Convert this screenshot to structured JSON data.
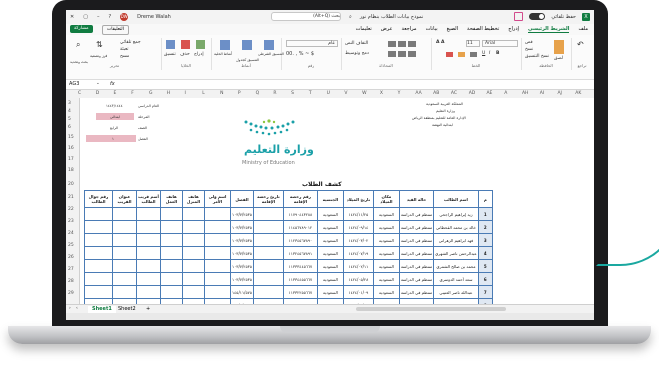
{
  "window": {
    "title": "نموذج بيانات الطلاب بنظام نور",
    "search_placeholder": "بحث (Alt+Q)",
    "user_name": "Dreme Walah",
    "user_initials": "DW",
    "autosave_label": "حفظ تلقائي"
  },
  "ribbon_tabs": {
    "file": "ملف",
    "home": "الشريط الرئيسي",
    "insert": "إدراج",
    "page_layout": "تخطيط الصفحة",
    "formulas": "الصيغ",
    "data": "بيانات",
    "review": "مراجعة",
    "view": "عرض",
    "help": "تعليمات"
  },
  "actions": {
    "share": "مشاركة",
    "comments": "التعليقات"
  },
  "ribbon_labels": {
    "undo": "تراجع",
    "clipboard": "الحافظة",
    "font": "الخط",
    "alignment": "المحاذاة",
    "number": "رقم",
    "styles": "أنماط",
    "cells": "الخلايا",
    "editing": "تحرير",
    "font_name": "Arial",
    "font_size": "11",
    "wrap_text": "التفاف النص",
    "merge_center": "دمج وتوسيط",
    "number_format": "عام",
    "conditional": "التنسيق الشرطي",
    "format_table": "التنسيق كجدول",
    "cell_styles": "أنماط الخلية",
    "insert": "إدراج",
    "delete": "حذف",
    "format": "تنسيق",
    "autosum": "جمع تلقائي",
    "fill": "تعبئة",
    "clear": "مسح",
    "sort_filter": "فرز وتصفية",
    "find_select": "بحث وتحديد",
    "paste": "لصق",
    "cut": "قص",
    "copy": "نسخ",
    "format_painter": "نسخ التنسيق"
  },
  "formula_bar": {
    "name_box": "AG3",
    "fx": "fx"
  },
  "columns": [
    "C",
    "D",
    "E",
    "F",
    "G",
    "H",
    "I",
    "L",
    "N",
    "P",
    "Q",
    "R",
    "S",
    "T",
    "U",
    "V",
    "W",
    "X",
    "Y",
    "AA",
    "AB",
    "AC",
    "AD",
    "AE",
    "A",
    "AH",
    "AI",
    "AJ",
    "AK"
  ],
  "rows": [
    "3",
    "4",
    "5",
    "6",
    "15",
    "16",
    "17",
    "18",
    "20",
    "21",
    "22",
    "23",
    "24",
    "25",
    "26",
    "27",
    "28",
    "29"
  ],
  "school_header": {
    "line1": "المملكة العربية السعودية",
    "line2": "وزارة التعليم",
    "line3": "الإدارة العامة للتعليم بمنطقة الرياض",
    "line4": "ابتدائية النهضة"
  },
  "info_left": {
    "date_label": "العام الدراسي",
    "date_value": "١٤٤٣/١٤٤٤",
    "stage_label": "المرحلة",
    "stage_value": "ابتدائي",
    "grade_label": "الصف",
    "grade_value": "الرابع",
    "section_label": "الفصل",
    "section_value": "١"
  },
  "logo": {
    "arabic": "وزارة التعليم",
    "english": "Ministry of Education"
  },
  "sheet_title": "كشف الطلاب",
  "table": {
    "headers": [
      "م",
      "اسم الطالب",
      "حالة القيد",
      "مكان الميلاد",
      "تاريخ الميلاد",
      "الجنسية",
      "رقم رخصة الإقامة",
      "تاريخ رخصة الإقامة",
      "الفصل",
      "اسم ولي الأمر",
      "هاتف المنزل",
      "هاتف العمل",
      "أسم قريب الطالب",
      "عنوان القريب",
      "رقم جوال الطالب"
    ],
    "rows": [
      [
        "1",
        "زيد إبراهيم الراجحي",
        "منتظم في الدراسة",
        "السعودية",
        "١٤٢٤/١١/٢٥",
        "السعودية",
        "١١٧٩٠٤٤٣٢٨٨",
        "",
        "١٠٣/٧/٢٥٣٥",
        "",
        "",
        "",
        "",
        "",
        ""
      ],
      [
        "2",
        "خالد بن محمد القحطاني",
        "منتظم في الدراسة",
        "السعودية",
        "١٤٢٤/٠٩/١٤",
        "السعودية",
        "١١٤٥٦٧٨٩٠١٢",
        "",
        "١٠٣/٧/٢٥٣٥",
        "",
        "",
        "",
        "",
        "",
        ""
      ],
      [
        "3",
        "فهد ابراهيم الزهراني",
        "منتظم في الدراسة",
        "السعودية",
        "١٤٢٤/٠٣/٠٢",
        "السعودية",
        "١١٢٣٤٥٦٧٨٩٠",
        "",
        "١٠٣/٧/٢٥٣٥",
        "",
        "",
        "",
        "",
        "",
        ""
      ],
      [
        "4",
        "عبدالرحمن ناصر الشهري",
        "منتظم في الدراسة",
        "السعودية",
        "١٤٢٤/٠٧/١٩",
        "السعودية",
        "١١٣٢٤٥٦٧٨٩١",
        "",
        "١٠٣/٧/٢٥٣٥",
        "",
        "",
        "",
        "",
        "",
        ""
      ],
      [
        "5",
        "محمد بن صالح الشمري",
        "منتظم في الدراسة",
        "السعودية",
        "١٤٢٤/٠٢/١١",
        "السعودية",
        "١١٣٣٣٤٤٥٦٦٧",
        "",
        "١٠٣/٧/٢٥٣٥",
        "",
        "",
        "",
        "",
        "",
        ""
      ],
      [
        "6",
        "سعد أحمد الدوسري",
        "منتظم في الدراسة",
        "السعودية",
        "١٤٢٤/٠٥/٢٨",
        "السعودية",
        "١١٣٣٤٤٥٥٦٦٧",
        "",
        "١٠٣/٧/٢٥٣٥",
        "",
        "",
        "",
        "",
        "",
        ""
      ],
      [
        "7",
        "عبدالله ناصر العتيبي",
        "منتظم في الدراسة",
        "السعودية",
        "١٤٢٤/٠١/٠٩",
        "السعودية",
        "١١٣٣٢٢٥٥٦٦٧",
        "",
        "١٤٥/١١/٥٧٥",
        "",
        "",
        "",
        "",
        "",
        ""
      ],
      [
        "8",
        "فارس بن عادل الغامدي",
        "منتظم في الدراسة",
        "السعودية",
        "١٤٢٤/٠٤/١٦",
        "السعودية",
        "١١٣٣٢٢٥٥٦٦٧",
        "",
        "١٠٣/٧/٢٥٣٥",
        "",
        "",
        "",
        "",
        "",
        ""
      ],
      [
        "9",
        "بندر بن خالد الحربي",
        "منتظم في الدراسة",
        "السعودية",
        "١٤٢٤/٠٦/٢٣",
        "السعودية",
        "١١٣٣٢٢٥٥٦٦٧",
        "",
        "١٠٣/٧/٢٥٣٥",
        "",
        "",
        "",
        "",
        "",
        ""
      ]
    ]
  },
  "sheet_tabs": [
    "Sheet1",
    "Sheet2"
  ],
  "add_sheet": "+"
}
